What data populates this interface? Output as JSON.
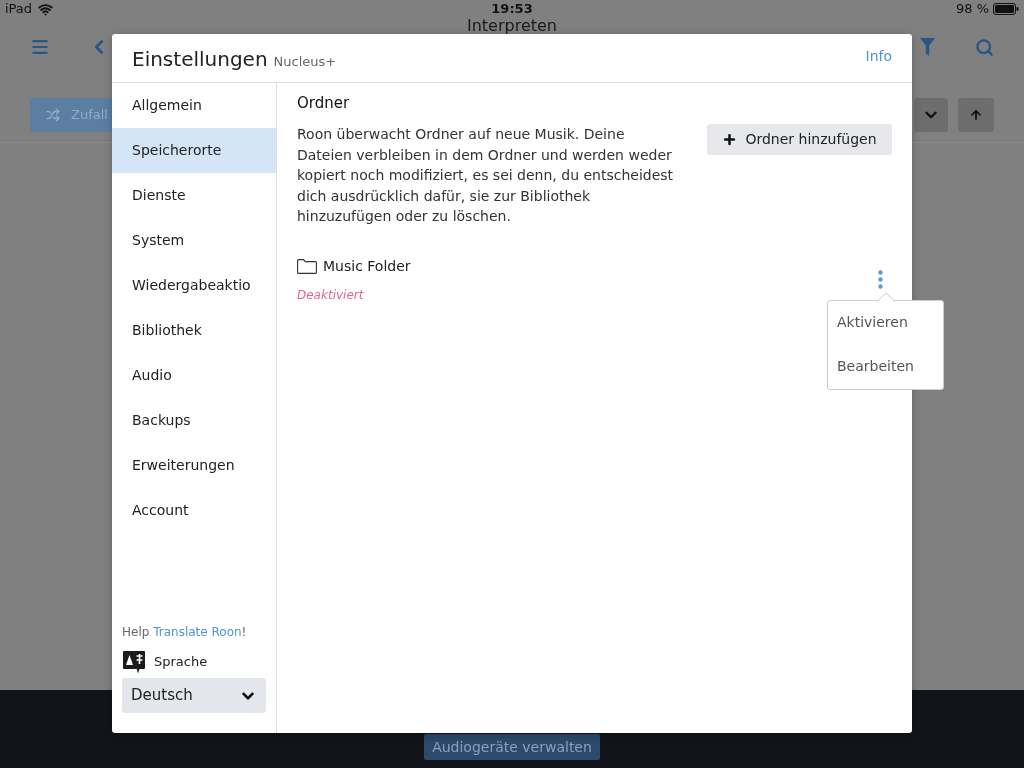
{
  "status_bar": {
    "device": "iPad",
    "time": "19:53",
    "battery": "98 %"
  },
  "app": {
    "title": "Interpreten",
    "shuffle_button": "Zufall",
    "bottom_button": "Audiogeräte verwalten"
  },
  "dialog": {
    "title": "Einstellungen",
    "subtitle": "Nucleus+",
    "info_link": "Info",
    "sidebar": {
      "items": [
        {
          "label": "Allgemein",
          "selected": false
        },
        {
          "label": "Speicherorte",
          "selected": true
        },
        {
          "label": "Dienste",
          "selected": false
        },
        {
          "label": "System",
          "selected": false
        },
        {
          "label": "Wiedergabeaktio",
          "selected": false
        },
        {
          "label": "Bibliothek",
          "selected": false
        },
        {
          "label": "Audio",
          "selected": false
        },
        {
          "label": "Backups",
          "selected": false
        },
        {
          "label": "Erweiterungen",
          "selected": false
        },
        {
          "label": "Account",
          "selected": false
        }
      ],
      "help": {
        "prefix": "Help",
        "link": "Translate Roon",
        "suffix": "!"
      },
      "language_label": "Sprache",
      "language_select": {
        "value": "Deutsch"
      }
    },
    "section": {
      "title": "Ordner",
      "description": "Roon überwacht Ordner auf neue Musik. Deine Dateien verbleiben in dem Ordner und werden weder kopiert noch modifiziert, es sei denn, du entscheidest dich ausdrücklich dafür, sie zur Bibliothek hinzuzufügen oder zu löschen.",
      "add_button": "Ordner hinzufügen",
      "folders": [
        {
          "name": "Music Folder",
          "status": "Deaktiviert",
          "enabled": false,
          "menu": {
            "expanded": true,
            "items": [
              "Aktivieren",
              "Bearbeiten"
            ]
          }
        }
      ]
    }
  }
}
